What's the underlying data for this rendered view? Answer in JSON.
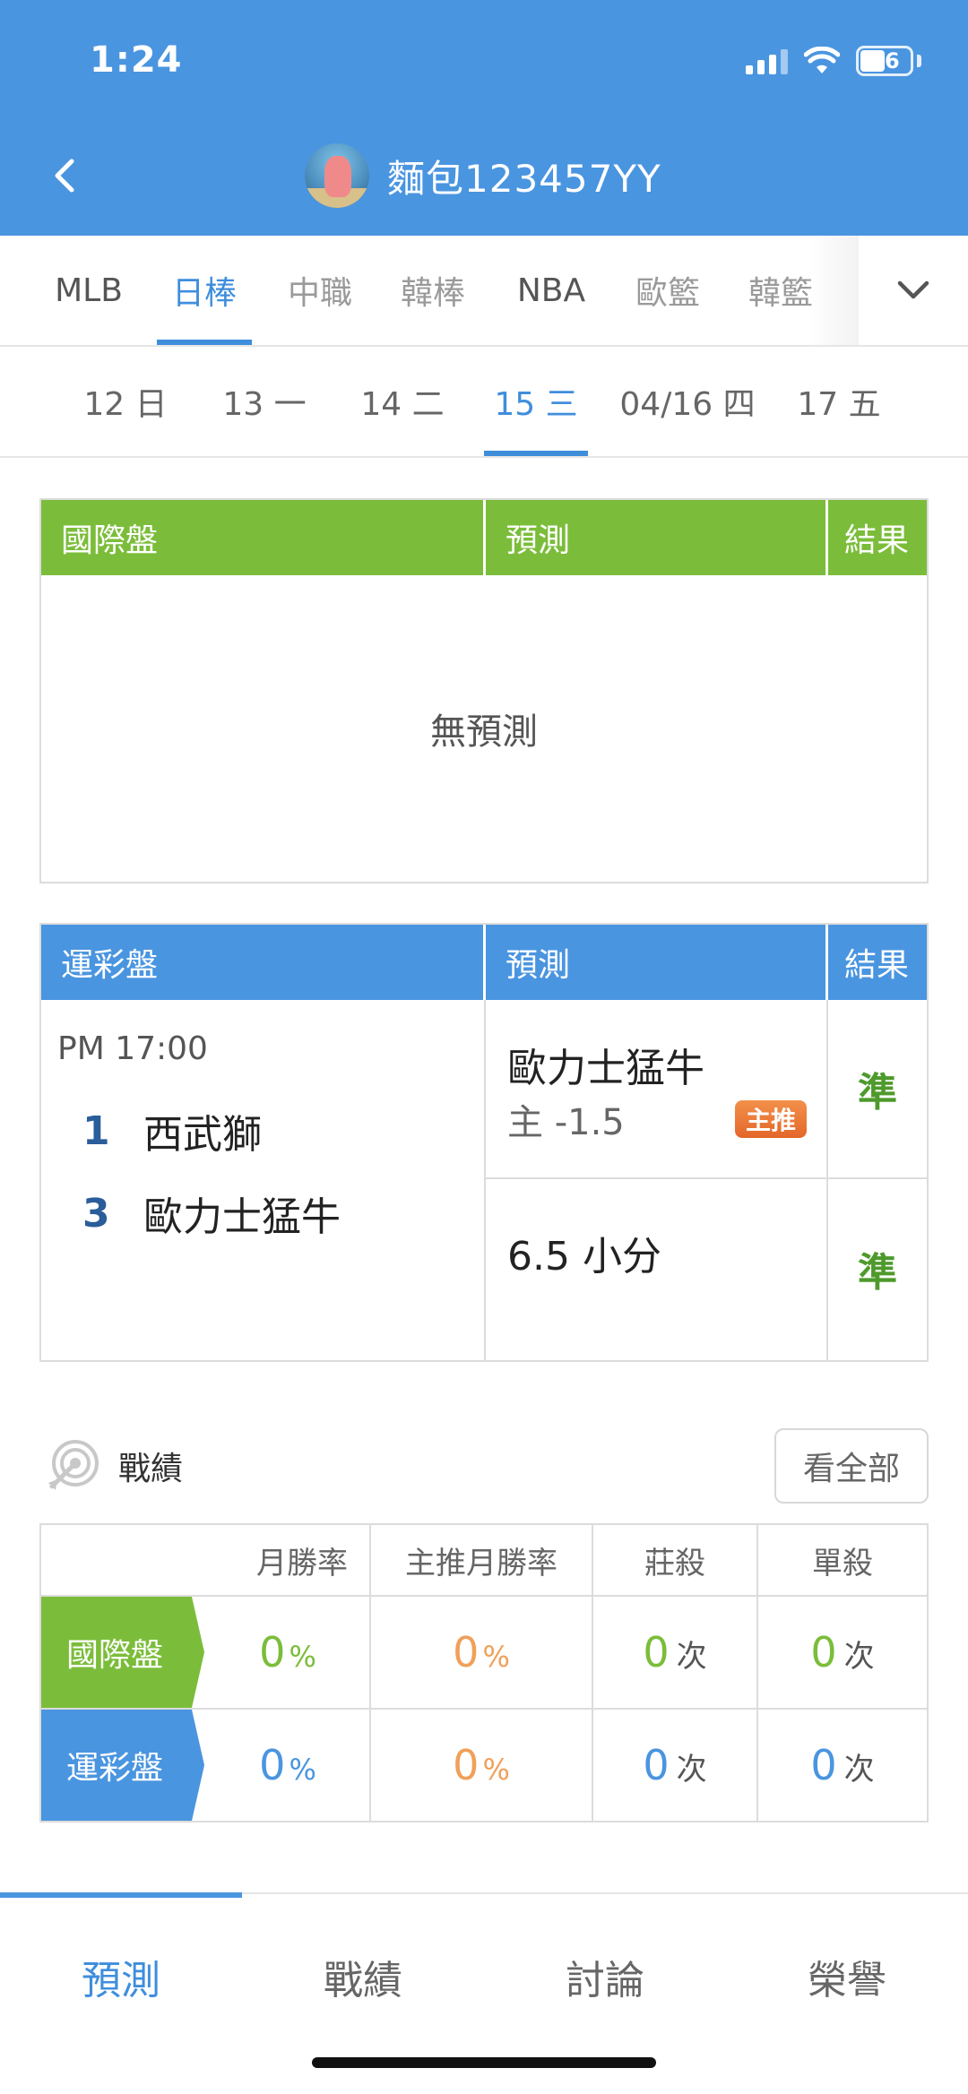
{
  "status_bar": {
    "time": "1:24",
    "battery": "46"
  },
  "header": {
    "username": "麵包123457YY"
  },
  "league_tabs": [
    {
      "label": "MLB"
    },
    {
      "label": "日棒"
    },
    {
      "label": "中職"
    },
    {
      "label": "韓棒"
    },
    {
      "label": "NBA"
    },
    {
      "label": "歐籃"
    },
    {
      "label": "韓籃"
    }
  ],
  "date_tabs": [
    {
      "label": "12 日"
    },
    {
      "label": "13 一"
    },
    {
      "label": "14 二"
    },
    {
      "label": "15 三"
    },
    {
      "label": "04/16 四"
    },
    {
      "label": "17 五"
    }
  ],
  "intl_table": {
    "col_market": "國際盤",
    "col_pred": "預測",
    "col_result": "結果",
    "empty_text": "無預測"
  },
  "sports_table": {
    "col_market": "運彩盤",
    "col_pred": "預測",
    "col_result": "結果",
    "game_time": "PM 17:00",
    "teams": [
      {
        "score": "1",
        "name": "西武獅"
      },
      {
        "score": "3",
        "name": "歐力士猛牛"
      }
    ],
    "picks": [
      {
        "line1": "歐力士猛牛",
        "line2": "主 -1.5",
        "badge": "主推",
        "result": "準"
      },
      {
        "line1": "6.5 小分",
        "result": "準"
      }
    ]
  },
  "record": {
    "title": "戰績",
    "view_all": "看全部",
    "headers": {
      "win_rate": "月勝率",
      "main_win_rate": "主推月勝率",
      "house_kill": "莊殺",
      "single_kill": "單殺"
    },
    "rows": [
      {
        "label": "國際盤",
        "win_rate": "0",
        "main_win_rate": "0",
        "house_kill": "0",
        "single_kill": "0"
      },
      {
        "label": "運彩盤",
        "win_rate": "0",
        "main_win_rate": "0",
        "house_kill": "0",
        "single_kill": "0"
      }
    ],
    "percent_unit": "%",
    "count_unit": "次"
  },
  "bottom_nav": [
    {
      "label": "預測"
    },
    {
      "label": "戰績"
    },
    {
      "label": "討論"
    },
    {
      "label": "榮譽"
    }
  ],
  "colors": {
    "primary_blue": "#4a95e0",
    "green": "#7bbd3a",
    "orange": "#f0a05a",
    "result_green": "#4e9a2c"
  }
}
